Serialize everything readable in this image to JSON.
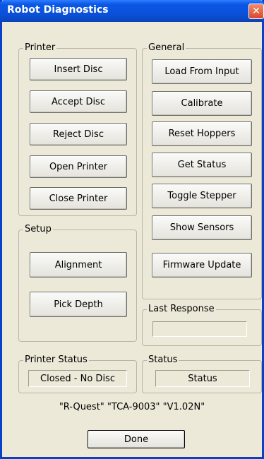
{
  "window": {
    "title": "Robot Diagnostics",
    "close_glyph": "✕"
  },
  "printer_group": {
    "legend": "Printer",
    "buttons": [
      "Insert Disc",
      "Accept Disc",
      "Reject Disc",
      "Open Printer",
      "Close Printer"
    ]
  },
  "setup_group": {
    "legend": "Setup",
    "buttons": [
      "Alignment",
      "Pick Depth"
    ]
  },
  "general_group": {
    "legend": "General",
    "buttons": [
      "Load From Input",
      "Calibrate",
      "Reset Hoppers",
      "Get Status",
      "Toggle Stepper",
      "Show Sensors",
      "Firmware Update"
    ]
  },
  "last_response": {
    "legend": "Last Response",
    "value": ""
  },
  "printer_status": {
    "legend": "Printer Status",
    "value": "Closed - No Disc"
  },
  "status": {
    "legend": "Status",
    "value": "Status"
  },
  "version_text": "\"R-Quest\" \"TCA-9003\" \"V1.02N\"",
  "done_label": "Done"
}
